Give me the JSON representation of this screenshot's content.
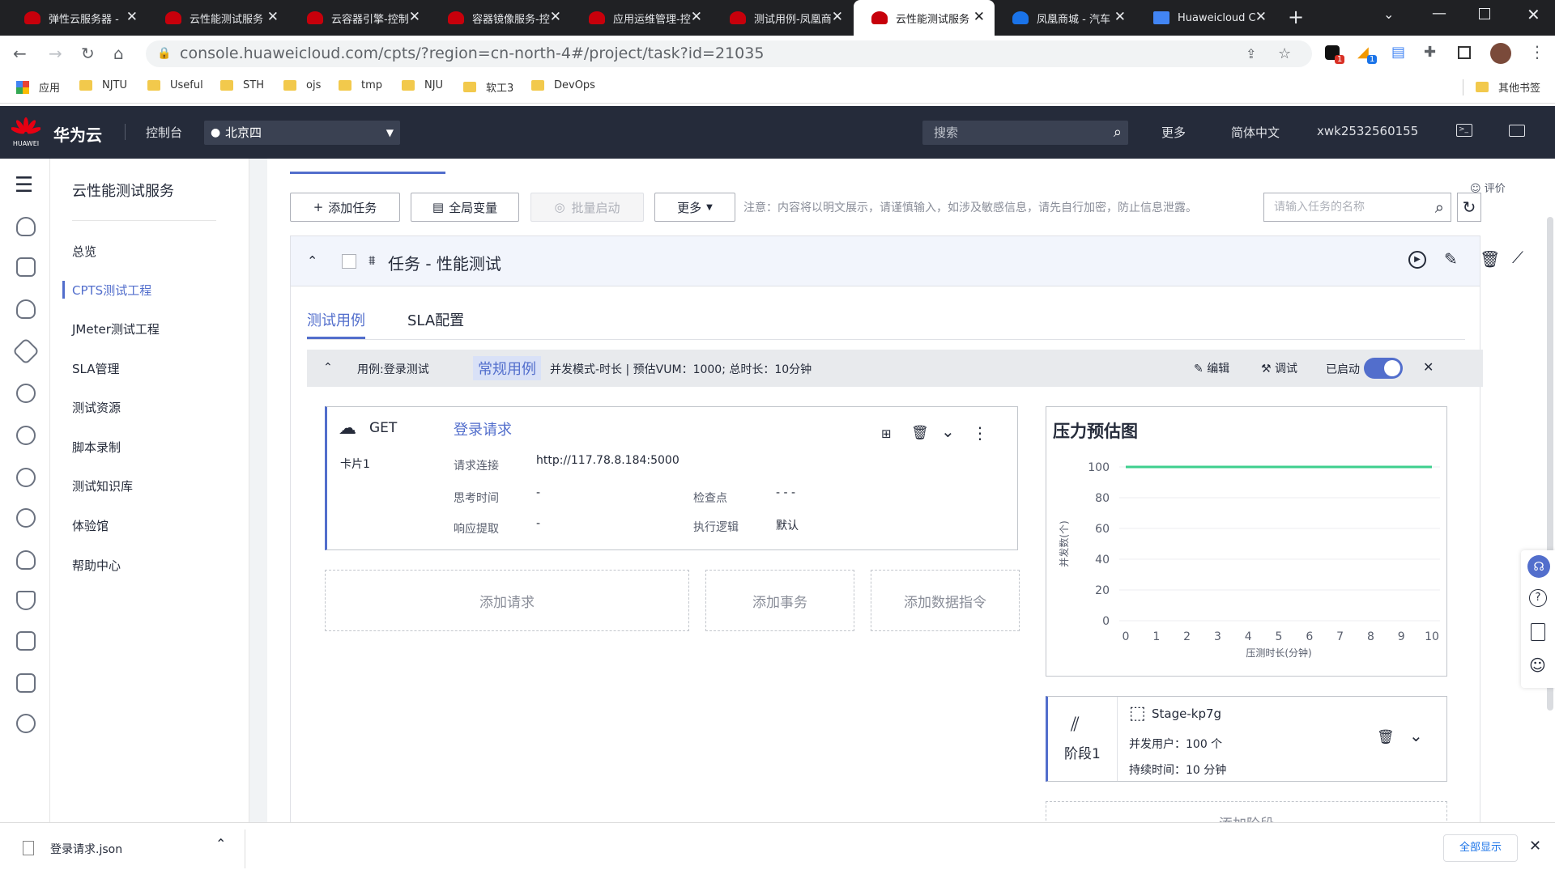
{
  "browser": {
    "tabs": [
      {
        "title": "弹性云服务器 -",
        "active": false
      },
      {
        "title": "云性能测试服务",
        "active": false
      },
      {
        "title": "云容器引擎-控制",
        "active": false
      },
      {
        "title": "容器镜像服务-控",
        "active": false
      },
      {
        "title": "应用运维管理-控",
        "active": false
      },
      {
        "title": "测试用例-凤凰商",
        "active": false
      },
      {
        "title": "云性能测试服务",
        "active": true
      },
      {
        "title": "凤凰商城 - 汽车",
        "active": false
      },
      {
        "title": "Huaweicloud C",
        "active": false
      }
    ],
    "url": "console.huaweicloud.com/cpts/?region=cn-north-4#/project/task?id=21035",
    "bookmarks": [
      "应用",
      "NJTU",
      "Useful",
      "STH",
      "ojs",
      "tmp",
      "NJU",
      "软工3",
      "DevOps"
    ],
    "other_bookmarks": "其他书签",
    "ext_badge_1": "1",
    "ext_badge_2": "1"
  },
  "header": {
    "logo_text": "HUAWEI",
    "brand": "华为云",
    "console": "控制台",
    "region": "北京四",
    "search_placeholder": "搜索",
    "more": "更多",
    "language": "简体中文",
    "user": "xwk2532560155"
  },
  "sidebar": {
    "title": "云性能测试服务",
    "items": [
      "总览",
      "CPTS测试工程",
      "JMeter测试工程",
      "SLA管理",
      "测试资源",
      "脚本录制",
      "测试知识库",
      "体验馆",
      "帮助中心"
    ],
    "active_index": 1
  },
  "toolbar": {
    "add_task": "添加任务",
    "global_vars": "全局变量",
    "batch_start": "批量启动",
    "more": "更多",
    "notice": "注意：内容将以明文展示，请谨慎输入，如涉及敏感信息，请先自行加密，防止信息泄露。",
    "search_placeholder": "请输入任务的名称",
    "evaluate": "评价"
  },
  "task": {
    "title": "任务 - 性能测试",
    "tabs": [
      "测试用例",
      "SLA配置"
    ],
    "case": {
      "name": "用例:登录测试",
      "type_badge": "常规用例",
      "summary": "并发模式-时长 | 预估VUM：1000; 总时长：10分钟",
      "edit": "编辑",
      "debug": "调试",
      "status": "已启动",
      "enabled": true
    },
    "request": {
      "method": "GET",
      "name": "登录请求",
      "card": "卡片1",
      "url_label": "请求连接",
      "url": "http://117.78.8.184:5000",
      "think_label": "思考时间",
      "think_value": "-",
      "check_label": "检查点",
      "check_value": "- - -",
      "extract_label": "响应提取",
      "extract_value": "-",
      "logic_label": "执行逻辑",
      "logic_value": "默认"
    },
    "add_request": "添加请求",
    "add_transaction": "添加事务",
    "add_data_cmd": "添加数据指令",
    "stage": {
      "label": "阶段1",
      "name": "Stage-kp7g",
      "users_label": "并发用户：",
      "users_value": "100 个",
      "duration_label": "持续时间：",
      "duration_value": "10 分钟"
    },
    "add_stage": "添加阶段"
  },
  "chart_data": {
    "type": "line",
    "title": "压力预估图",
    "xlabel": "压测时长(分钟)",
    "ylabel": "并发数(个)",
    "x": [
      0,
      10
    ],
    "series": [
      {
        "values": [
          100,
          100
        ],
        "color": "#3ecf8e"
      }
    ],
    "xticks": [
      0,
      1,
      2,
      3,
      4,
      5,
      6,
      7,
      8,
      9,
      10
    ],
    "yticks": [
      0,
      20,
      40,
      60,
      80,
      100
    ],
    "xlim": [
      0,
      10
    ],
    "ylim": [
      0,
      100
    ],
    "grid": true
  },
  "download": {
    "file": "登录请求.json",
    "show_all": "全部显示"
  },
  "colors": {
    "accent": "#526ecc",
    "brand": "#c7000b",
    "topbar": "#252b3a",
    "toggle": "#526ecc"
  }
}
